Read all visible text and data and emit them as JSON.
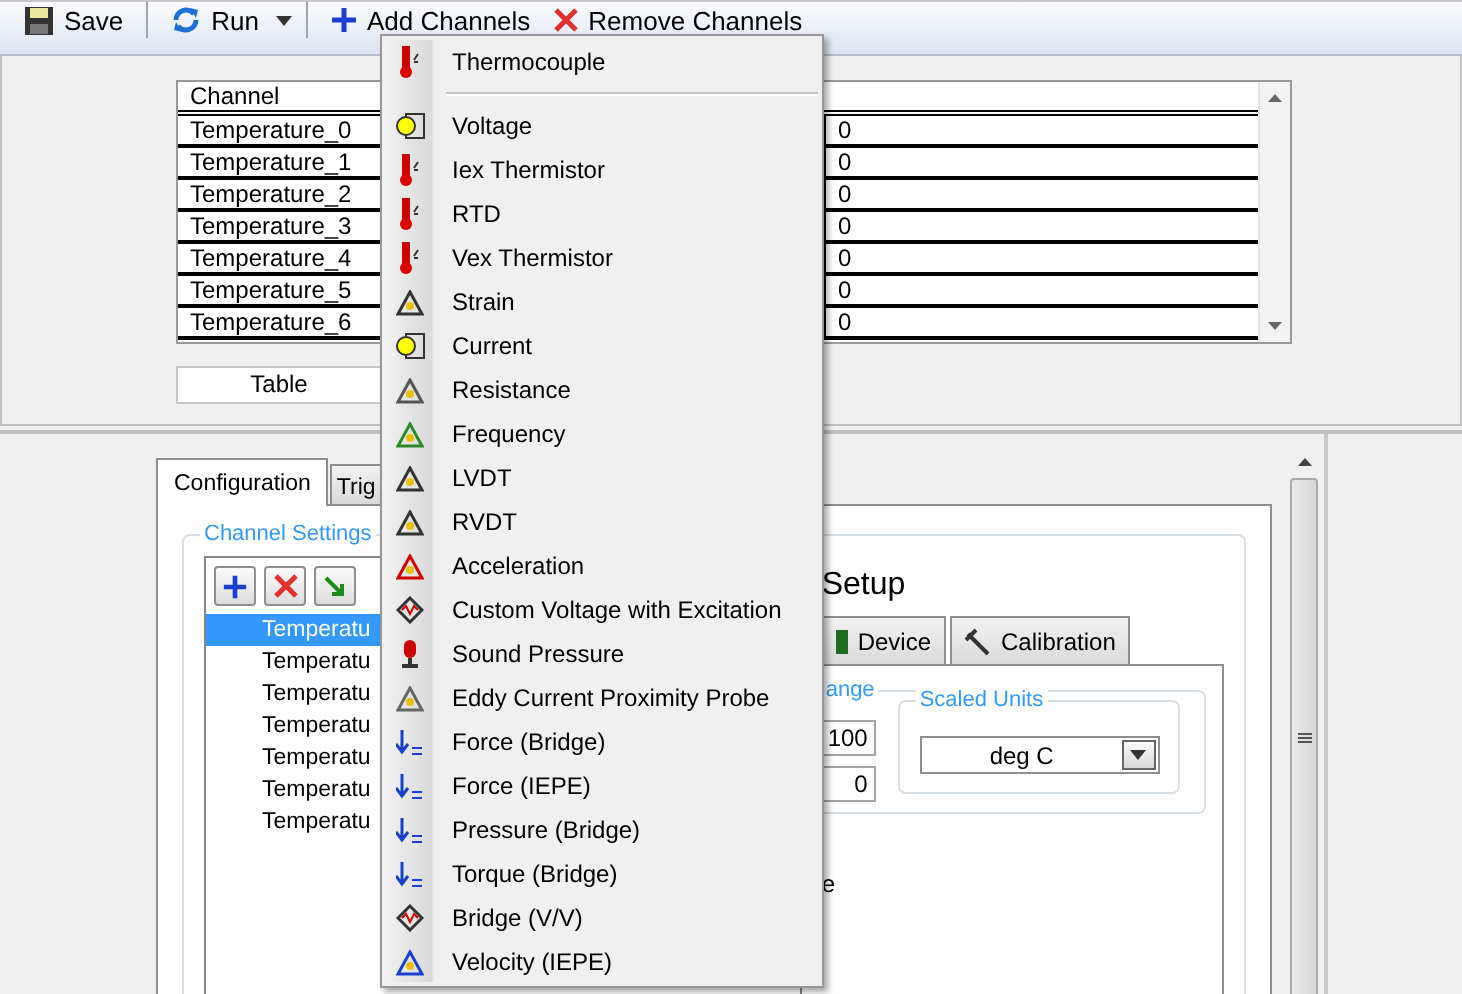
{
  "toolbar": [
    {
      "label": "Save"
    },
    {
      "label": "Run"
    },
    {
      "label": "Add Channels"
    },
    {
      "label": "Remove Channels"
    }
  ],
  "channel_table": {
    "columns": [
      "Channel"
    ],
    "rows": [
      {
        "channel": "Temperature_0",
        "value": "0"
      },
      {
        "channel": "Temperature_1",
        "value": "0"
      },
      {
        "channel": "Temperature_2",
        "value": "0"
      },
      {
        "channel": "Temperature_3",
        "value": "0"
      },
      {
        "channel": "Temperature_4",
        "value": "0"
      },
      {
        "channel": "Temperature_5",
        "value": "0"
      },
      {
        "channel": "Temperature_6",
        "value": "0"
      }
    ]
  },
  "view_select": {
    "value": "Table"
  },
  "tabs": [
    {
      "label": "Configuration",
      "selected": true
    },
    {
      "label": "Trig",
      "selected": false
    }
  ],
  "channel_settings": {
    "title": "Channel Settings",
    "channels": [
      {
        "name": "Temperatu",
        "selected": true
      },
      {
        "name": "Temperatu",
        "selected": false
      },
      {
        "name": "Temperatu",
        "selected": false
      },
      {
        "name": "Temperatu",
        "selected": false
      },
      {
        "name": "Temperatu",
        "selected": false
      },
      {
        "name": "Temperatu",
        "selected": false
      },
      {
        "name": "Temperatu",
        "selected": false
      }
    ]
  },
  "setup": {
    "title": "Setup",
    "tabs": [
      {
        "label": "Device",
        "selected": false
      },
      {
        "label": "Calibration",
        "selected": false
      }
    ],
    "range_group": {
      "title": "ange",
      "max": "100",
      "min": "0"
    },
    "scaled_units": {
      "title": "Scaled Units",
      "value": "deg C"
    },
    "note": "e"
  },
  "menu": {
    "items": [
      {
        "kind": "item",
        "label": "Thermocouple"
      },
      {
        "kind": "separator"
      },
      {
        "kind": "item",
        "label": "Voltage"
      },
      {
        "kind": "item",
        "label": "Iex Thermistor"
      },
      {
        "kind": "item",
        "label": "RTD"
      },
      {
        "kind": "item",
        "label": "Vex Thermistor"
      },
      {
        "kind": "item",
        "label": "Strain"
      },
      {
        "kind": "item",
        "label": "Current"
      },
      {
        "kind": "item",
        "label": "Resistance"
      },
      {
        "kind": "item",
        "label": "Frequency"
      },
      {
        "kind": "item",
        "label": "LVDT"
      },
      {
        "kind": "item",
        "label": "RVDT"
      },
      {
        "kind": "item",
        "label": "Acceleration"
      },
      {
        "kind": "item",
        "label": "Custom Voltage with Excitation"
      },
      {
        "kind": "item",
        "label": "Sound Pressure"
      },
      {
        "kind": "item",
        "label": "Eddy Current Proximity Probe"
      },
      {
        "kind": "item",
        "label": "Force (Bridge)"
      },
      {
        "kind": "item",
        "label": "Force (IEPE)"
      },
      {
        "kind": "item",
        "label": "Pressure (Bridge)"
      },
      {
        "kind": "item",
        "label": "Torque (Bridge)"
      },
      {
        "kind": "item",
        "label": "Bridge (V/V)"
      },
      {
        "kind": "item",
        "label": "Velocity (IEPE)"
      }
    ]
  }
}
